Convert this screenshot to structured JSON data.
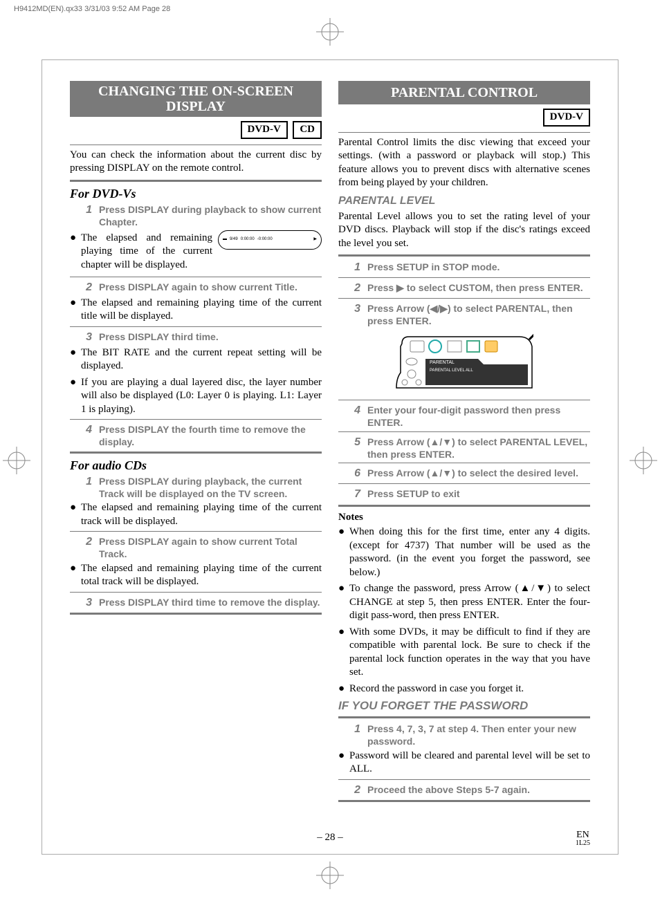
{
  "slug": "H9412MD(EN).qx33  3/31/03 9:52 AM  Page 28",
  "left": {
    "banner": "CHANGING THE ON-SCREEN DISPLAY",
    "tag1": "DVD-V",
    "tag2": "CD",
    "intro": "You can check the information about the current disc by pressing DISPLAY on the remote control.",
    "dvdHead": "For DVD-Vs",
    "d1": "Press DISPLAY during playback to show current Chapter.",
    "d1b": "The elapsed and remaining playing time of the current chapter will be displayed.",
    "osd_left": "9/49",
    "osd_mid": "0:00:00",
    "osd_right": "-0:00:00",
    "d2": "Press DISPLAY again to show current Title.",
    "d2b": "The elapsed and remaining playing time of the current title will be displayed.",
    "d3": "Press DISPLAY third time.",
    "d3b1": "The BIT RATE and the current repeat setting will be displayed.",
    "d3b2": "If you are playing a dual layered disc, the layer number will also be displayed (L0: Layer 0 is playing. L1: Layer 1 is playing).",
    "d4": "Press DISPLAY the fourth time to remove the display.",
    "cdHead": "For audio CDs",
    "c1": "Press DISPLAY during playback, the current Track will be displayed on the TV screen.",
    "c1b": "The elapsed and remaining playing time of the current track will be displayed.",
    "c2": "Press DISPLAY again to show current Total Track.",
    "c2b": "The elapsed and remaining playing time of the current total track will be displayed.",
    "c3": "Press DISPLAY third time to remove the display."
  },
  "right": {
    "banner": "PARENTAL CONTROL",
    "tag": "DVD-V",
    "intro": "Parental Control limits the disc viewing that exceed your settings. (with a password or playback will stop.) This feature allows you to prevent discs with alternative scenes from being played by your children.",
    "levelHead": "PARENTAL LEVEL",
    "levelPara": "Parental Level allows you to set the rating level of your DVD discs. Playback will stop if the disc's ratings exceed the level you set.",
    "s1": "Press SETUP in STOP mode.",
    "s2": "Press ▶ to select CUSTOM, then press ENTER.",
    "s3": "Press Arrow (◀/▶) to select PARENTAL, then press ENTER.",
    "illus_tab": "PARENTAL",
    "illus_line": "PARENTAL LEVEL    ALL",
    "s4": "Enter your four-digit password then press ENTER.",
    "s5": "Press Arrow (▲/▼) to select PARENTAL LEVEL, then press ENTER.",
    "s6": "Press Arrow (▲/▼) to select the desired level.",
    "s7": "Press SETUP to exit",
    "notes": "Notes",
    "n1": "When doing this for the first time, enter any 4 digits. (except for 4737) That number will be used as the password. (in the event you forget the password, see below.)",
    "n2": "To change the password, press Arrow (▲/▼) to select CHANGE at step 5, then press ENTER. Enter the four-digit pass-word, then press ENTER.",
    "n3": "With some DVDs, it may be difficult to find if they are compatible with parental lock. Be sure to check if the parental lock function operates in the way that you have set.",
    "n4": "Record the password in case you forget it.",
    "forgotHead": "IF YOU FORGET THE PASSWORD",
    "f1": "Press 4, 7, 3, 7 at step 4. Then enter your new password.",
    "f1b": "Password will be cleared and parental level will be set to ALL.",
    "f2": "Proceed the above Steps 5-7 again."
  },
  "footer": {
    "page": "– 28 –",
    "lang": "EN",
    "code": "1L25"
  }
}
